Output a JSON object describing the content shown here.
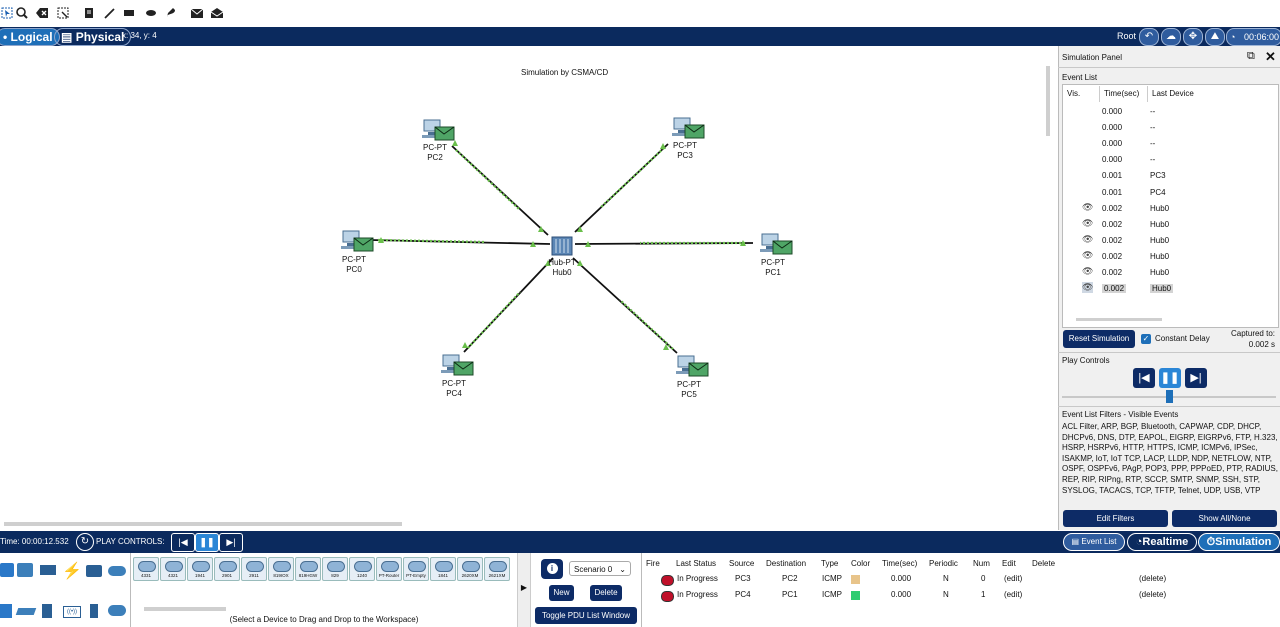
{
  "toolbar": {
    "icons": [
      "select-icon",
      "inspect-icon",
      "delete-icon",
      "resize-icon",
      "note-icon",
      "line-icon",
      "rectangle-icon",
      "ellipse-icon",
      "freeform-icon",
      "simple-pdu-icon",
      "complex-pdu-icon"
    ]
  },
  "modebar": {
    "logical_label": "Logical",
    "physical_label": "Physical",
    "coords": "x: 34, y: 4",
    "root_label": "Root",
    "time": "00:06:00"
  },
  "workspace": {
    "title": "Simulation by CSMA/CD",
    "hub": {
      "type": "Hub-PT",
      "name": "Hub0"
    },
    "devices": [
      {
        "type": "PC-PT",
        "name": "PC2"
      },
      {
        "type": "PC-PT",
        "name": "PC3"
      },
      {
        "type": "PC-PT",
        "name": "PC0"
      },
      {
        "type": "PC-PT",
        "name": "PC1"
      },
      {
        "type": "PC-PT",
        "name": "PC4"
      },
      {
        "type": "PC-PT",
        "name": "PC5"
      }
    ]
  },
  "sim_panel": {
    "title": "Simulation Panel",
    "event_list_label": "Event List",
    "columns": [
      "Vis.",
      "Time(sec)",
      "Last Device"
    ],
    "events": [
      {
        "visible": false,
        "time": "0.000",
        "device": "--"
      },
      {
        "visible": false,
        "time": "0.000",
        "device": "--"
      },
      {
        "visible": false,
        "time": "0.000",
        "device": "--"
      },
      {
        "visible": false,
        "time": "0.000",
        "device": "--"
      },
      {
        "visible": false,
        "time": "0.001",
        "device": "PC3"
      },
      {
        "visible": false,
        "time": "0.001",
        "device": "PC4"
      },
      {
        "visible": true,
        "time": "0.002",
        "device": "Hub0"
      },
      {
        "visible": true,
        "time": "0.002",
        "device": "Hub0"
      },
      {
        "visible": true,
        "time": "0.002",
        "device": "Hub0"
      },
      {
        "visible": true,
        "time": "0.002",
        "device": "Hub0"
      },
      {
        "visible": true,
        "time": "0.002",
        "device": "Hub0"
      },
      {
        "visible": true,
        "time": "0.002",
        "device": "Hub0"
      }
    ],
    "reset_label": "Reset Simulation",
    "constant_delay_label": "Constant Delay",
    "constant_delay_checked": true,
    "captured_label": "Captured to:",
    "captured_value": "0.002 s",
    "play_controls_label": "Play Controls",
    "filters_title": "Event List Filters - Visible Events",
    "filters_text": "ACL Filter, ARP, BGP, Bluetooth, CAPWAP, CDP, DHCP, DHCPv6, DNS, DTP, EAPOL, EIGRP, EIGRPv6, FTP, H.323, HSRP, HSRPv6, HTTP, HTTPS, ICMP, ICMPv6, IPSec, ISAKMP, IoT, IoT TCP, LACP, LLDP, NDP, NETFLOW, NTP, OSPF, OSPFv6, PAgP, POP3, PPP, PPPoED, PTP, RADIUS, REP, RIP, RIPng, RTP, SCCP, SMTP, SNMP, SSH, STP, SYSLOG, TACACS, TCP, TFTP, Telnet, UDP, USB, VTP",
    "edit_filters_label": "Edit Filters",
    "show_all_label": "Show All/None"
  },
  "bottombar": {
    "time_label": "Time: 00:00:12.532",
    "play_controls_label": "PLAY CONTROLS:",
    "event_list_label": "Event List",
    "realtime_label": "Realtime",
    "simulation_label": "Simulation"
  },
  "device_box": {
    "models": [
      "4331",
      "4321",
      "1941",
      "2901",
      "2911",
      "819IOX",
      "819HGW",
      "829",
      "1240",
      "PT-Router",
      "PT-Empty",
      "1841",
      "2620XM",
      "2621XM"
    ],
    "hint": "(Select a Device to Drag and Drop to the Workspace)"
  },
  "scenario": {
    "selected": "Scenario 0",
    "new_label": "New",
    "delete_label": "Delete",
    "toggle_label": "Toggle PDU List Window"
  },
  "pdu_list": {
    "columns": [
      "Fire",
      "Last Status",
      "Source",
      "Destination",
      "Type",
      "Color",
      "Time(sec)",
      "Periodic",
      "Num",
      "Edit",
      "Delete"
    ],
    "rows": [
      {
        "status": "In Progress",
        "source": "PC3",
        "destination": "PC2",
        "type": "ICMP",
        "color": "#e8c48a",
        "time": "0.000",
        "periodic": "N",
        "num": "0",
        "edit": "(edit)",
        "delete": "(delete)"
      },
      {
        "status": "In Progress",
        "source": "PC4",
        "destination": "PC1",
        "type": "ICMP",
        "color": "#2ecc71",
        "time": "0.000",
        "periodic": "N",
        "num": "1",
        "edit": "(edit)",
        "delete": "(delete)"
      }
    ]
  }
}
